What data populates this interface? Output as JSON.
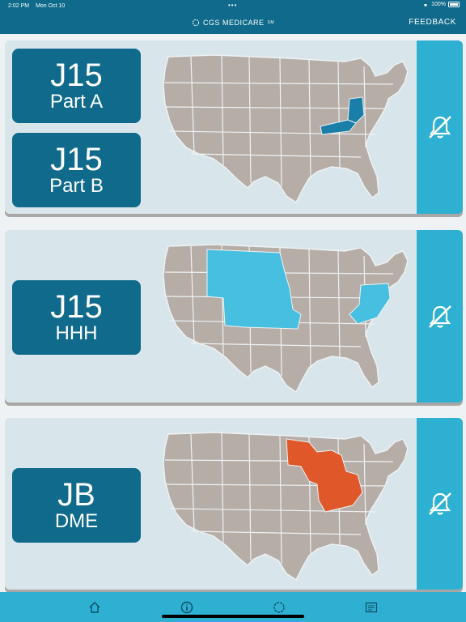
{
  "status": {
    "time": "2:02 PM",
    "date": "Mon Oct 10",
    "battery": "100%"
  },
  "header": {
    "brand": "CGS MEDICARE",
    "brand_mark": "SM",
    "feedback": "FEEDBACK"
  },
  "cards": [
    {
      "buttons": [
        {
          "code": "J15",
          "sub": "Part A"
        },
        {
          "code": "J15",
          "sub": "Part B"
        }
      ],
      "highlight_color": "#1a7fa8",
      "highlighted_states": [
        "Ohio",
        "Kentucky"
      ],
      "notify_icon": "bell-off-icon"
    },
    {
      "buttons": [
        {
          "code": "J15",
          "sub": "HHH"
        }
      ],
      "highlight_color": "#46bfe0",
      "highlighted_states": [
        "Montana",
        "North Dakota",
        "South Dakota",
        "Wyoming",
        "Nebraska",
        "Colorado",
        "Kansas",
        "Iowa",
        "Missouri",
        "Pennsylvania",
        "New Jersey",
        "Delaware",
        "Maryland",
        "Virginia",
        "West Virginia"
      ],
      "notify_icon": "bell-off-icon"
    },
    {
      "buttons": [
        {
          "code": "JB",
          "sub": "DME"
        }
      ],
      "highlight_color": "#e0582a",
      "highlighted_states": [
        "Minnesota",
        "Wisconsin",
        "Michigan",
        "Illinois",
        "Indiana",
        "Ohio",
        "Kentucky"
      ],
      "notify_icon": "bell-off-icon"
    }
  ],
  "tabs": [
    {
      "name": "home",
      "icon": "home-icon"
    },
    {
      "name": "info",
      "icon": "info-icon"
    },
    {
      "name": "cgs",
      "icon": "cgs-logo-icon"
    },
    {
      "name": "news",
      "icon": "newspaper-icon"
    }
  ],
  "colors": {
    "nav": "#0f6a8b",
    "accent": "#2db0d2",
    "map_base": "#b6ada7",
    "card_bg": "#d8e6ec"
  }
}
